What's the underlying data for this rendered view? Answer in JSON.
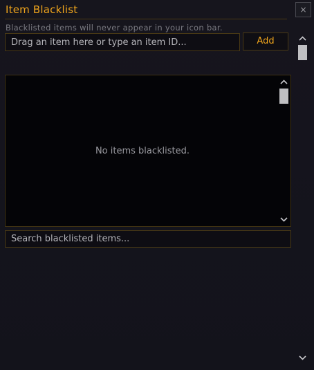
{
  "window": {
    "title": "Item Blacklist",
    "close_glyph": "×"
  },
  "subtitle": "Blacklisted items will never appear in your icon bar.",
  "item_input": {
    "placeholder": "Drag an item here or type an item ID..."
  },
  "add_button": {
    "label": "Add"
  },
  "list": {
    "empty_text": "No items blacklisted."
  },
  "search": {
    "placeholder": "Search blacklisted items..."
  },
  "icons": {
    "scroll_up": "chevron-up-icon",
    "scroll_down": "chevron-down-icon"
  },
  "colors": {
    "accent": "#f0a51c",
    "border": "#4a3a14",
    "background": "#15141d"
  }
}
